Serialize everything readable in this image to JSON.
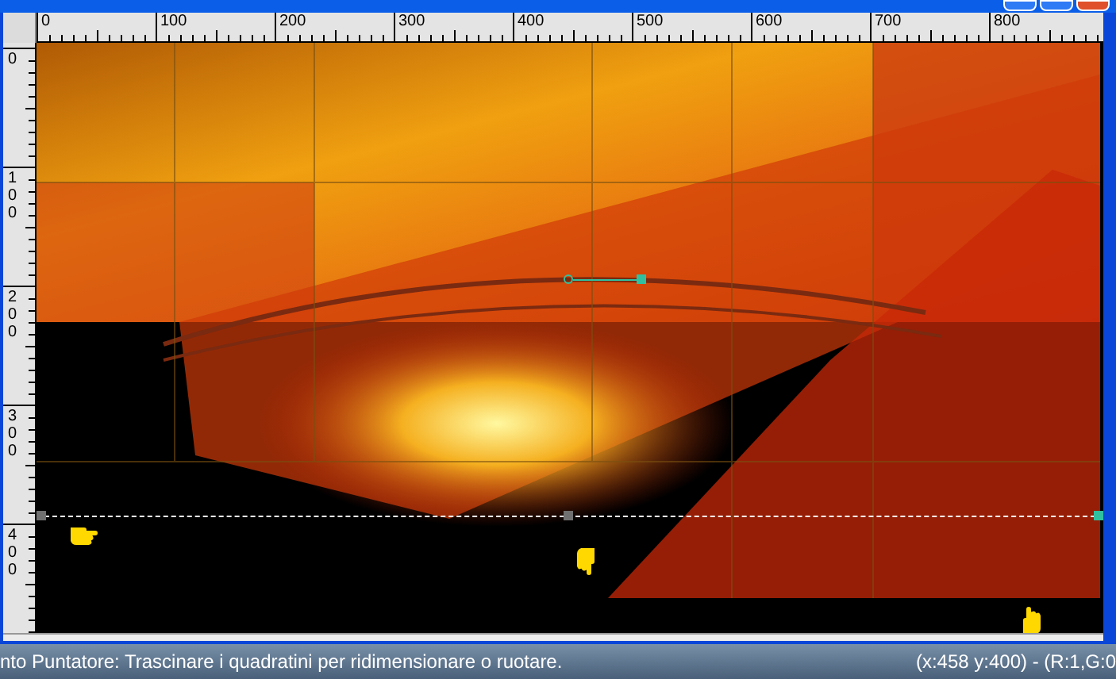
{
  "ruler_top": {
    "labels": [
      "0",
      "100",
      "200",
      "300",
      "400",
      "500",
      "600",
      "700",
      "800"
    ]
  },
  "ruler_left": {
    "labels": [
      "0",
      "100",
      "200",
      "300",
      "400"
    ]
  },
  "status_bar": {
    "hint": "nto Puntatore: Trascinare i quadratini per ridimensionare o ruotare.",
    "position": "(x:458 y:400) - (R:1,G:0"
  }
}
